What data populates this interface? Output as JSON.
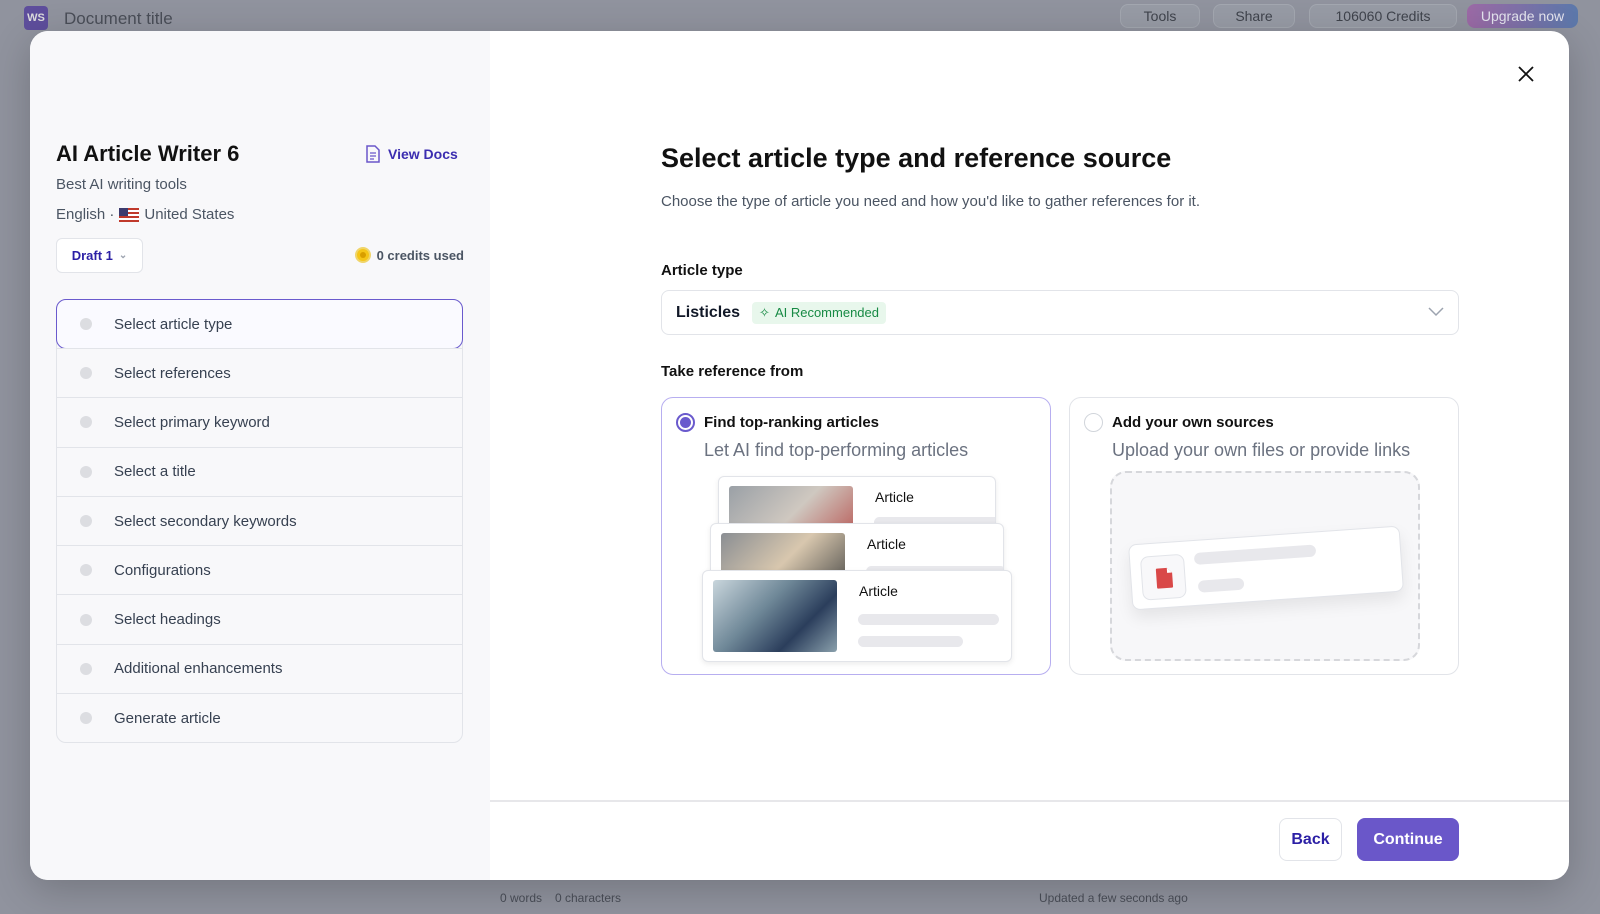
{
  "background": {
    "document_title": "Document title",
    "logo_text": "WS",
    "tools_label": "Tools",
    "share_label": "Share",
    "credits_label": "106060 Credits",
    "upgrade_label": "Upgrade now",
    "word_count": "0 words",
    "char_count": "0 characters",
    "updated": "Updated a few seconds ago"
  },
  "sidebar": {
    "title": "AI Article Writer 6",
    "view_docs": "View Docs",
    "keyword": "Best AI writing tools",
    "language": "English ·",
    "country": "United States",
    "draft": "Draft 1",
    "credits_used": "0 credits used",
    "steps": [
      {
        "label": "Select article type",
        "active": true
      },
      {
        "label": "Select references"
      },
      {
        "label": "Select primary keyword"
      },
      {
        "label": "Select a title"
      },
      {
        "label": "Select secondary keywords"
      },
      {
        "label": "Configurations"
      },
      {
        "label": "Select headings"
      },
      {
        "label": "Additional enhancements"
      },
      {
        "label": "Generate article"
      }
    ]
  },
  "main": {
    "heading": "Select article type and reference source",
    "description": "Choose the type of article you need and how you'd like to gather references for it.",
    "article_type_label": "Article type",
    "article_type_value": "Listicles",
    "ai_badge": "AI Recommended",
    "reference_label": "Take reference from",
    "options": [
      {
        "title": "Find top-ranking articles",
        "subtitle": "Let AI find top-performing articles",
        "selected": true,
        "preview_label": "Article"
      },
      {
        "title": "Add your own sources",
        "subtitle": "Upload your own files or provide links",
        "selected": false
      }
    ],
    "back_label": "Back",
    "continue_label": "Continue"
  },
  "colors": {
    "accent": "#6a57c9",
    "link": "#2b1fa5",
    "badge_green": "#178a44",
    "file_red": "#d94848"
  }
}
